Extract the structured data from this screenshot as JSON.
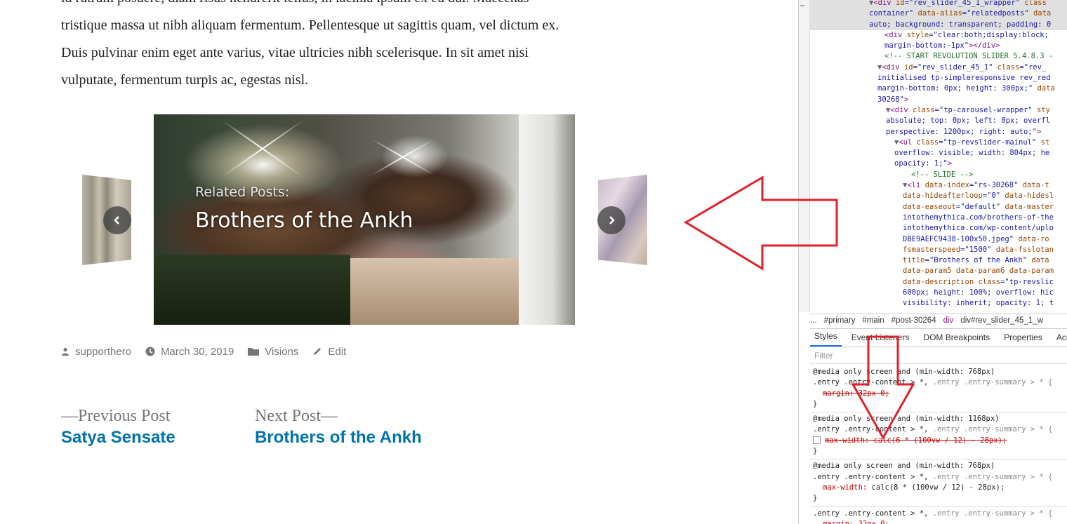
{
  "article": {
    "lines": [
      "id rutrum posuere, diam risus hendrerit tellus, in lacinia ipsum ex eu dui. Maecenas",
      "tristique massa ut nibh aliquam fermentum. Pellentesque ut sagittis quam, vel dictum ex.",
      "Duis pulvinar enim eget ante varius, vitae ultricies nibh scelerisque. In sit amet nisi",
      "vulputate, fermentum turpis ac, egestas nisl."
    ]
  },
  "slider": {
    "kicker": "Related Posts:",
    "title": "Brothers of the Ankh"
  },
  "meta": {
    "author": "supporthero",
    "date": "March 30, 2019",
    "category": "Visions",
    "edit": "Edit"
  },
  "post_nav": {
    "prev_kicker": "—Previous Post",
    "prev_title": "Satya Sensate",
    "next_kicker": "Next Post—",
    "next_title": "Brothers of the Ankh"
  },
  "devtools": {
    "breadcrumbs": [
      "...",
      "#primary",
      "#main",
      "#post-30264",
      "div",
      "div#rev_slider_45_1_w"
    ],
    "tabs": [
      "Styles",
      "Event Listeners",
      "DOM Breakpoints",
      "Properties",
      "Acce"
    ],
    "filter_placeholder": "Filter"
  },
  "colors": {
    "link": "#0073aa",
    "annotation_arrow": "#e0202a",
    "meta_text": "#767676"
  }
}
